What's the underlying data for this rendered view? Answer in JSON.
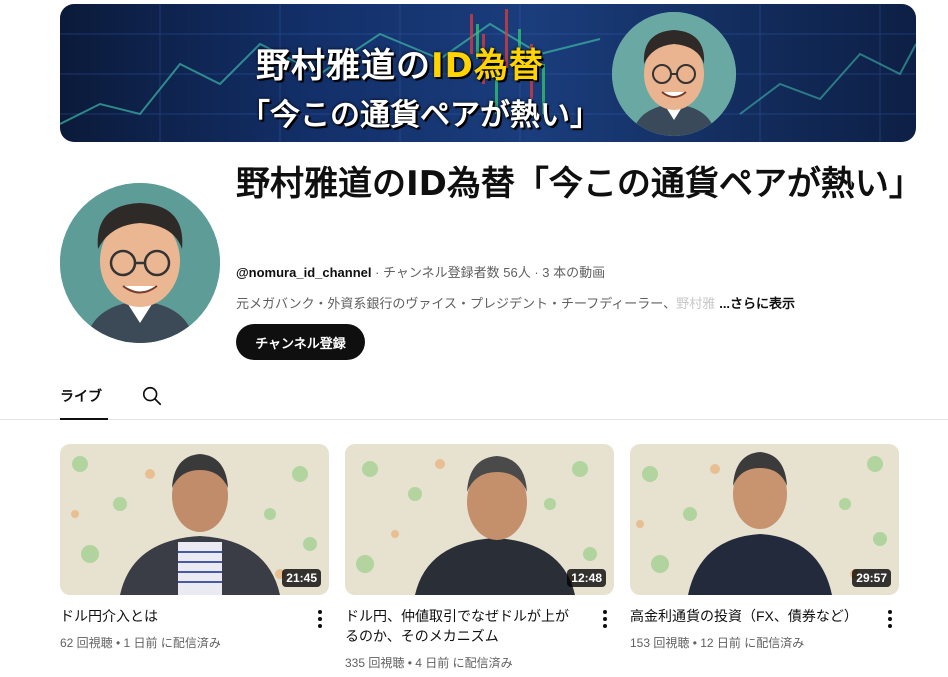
{
  "banner": {
    "line1_pre": "野村雅道の",
    "line1_accent": "ID為替",
    "line2": "「今この通貨ペアが熱い」"
  },
  "channel": {
    "title": "野村雅道のID為替「今この通貨ペアが熱い」",
    "handle": "@nomura_id_channel",
    "subscribers": " · チャンネル登録者数 56人 · 3 本の動画",
    "description": "元メガバンク・外資系銀行のヴァイス・プレジデント・チーフディーラー、",
    "description_fade": "野村雅",
    "more": "...さらに表示",
    "subscribe_label": "チャンネル登録"
  },
  "tabs": {
    "live": "ライブ",
    "search_icon": "search-icon"
  },
  "videos": [
    {
      "title": "ドル円介入とは",
      "duration": "21:45",
      "meta": "62 回視聴 • 1 日前 に配信済み"
    },
    {
      "title": "ドル円、仲値取引でなぜドルが上がるのか、そのメカニズム",
      "duration": "12:48",
      "meta": "335 回視聴 • 4 日前 に配信済み"
    },
    {
      "title": "高金利通貨の投資（FX、債券など）",
      "duration": "29:57",
      "meta": "153 回視聴 • 12 日前 に配信済み"
    }
  ],
  "colors": {
    "accent_yellow": "#ffd400",
    "banner_blue": "#13306a",
    "button_black": "#0f0f0f",
    "meta_gray": "#606060"
  }
}
